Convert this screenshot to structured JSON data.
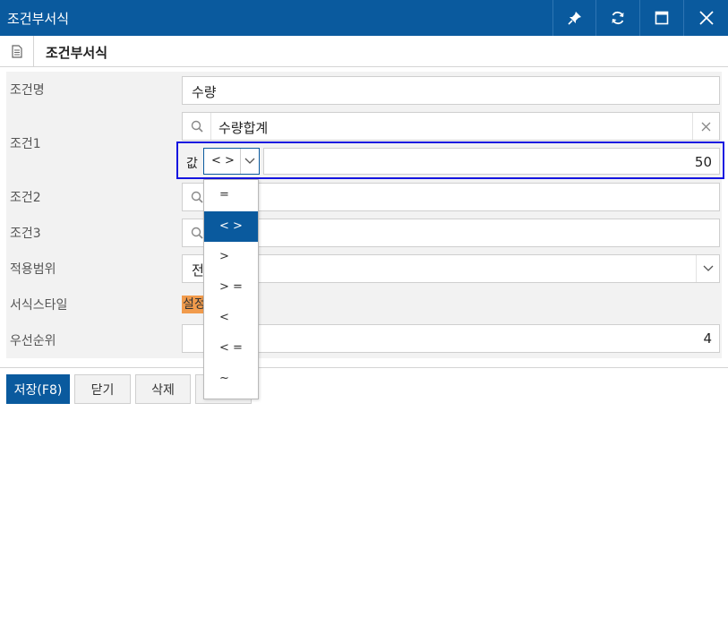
{
  "window": {
    "title": "조건부서식"
  },
  "tab": {
    "title": "조건부서식"
  },
  "form": {
    "name_label": "조건명",
    "name_value": "수량",
    "cond1_label": "조건1",
    "cond1_field": "수량합계",
    "cond1_value_label": "값",
    "cond1_operator": "< >",
    "cond1_value": "50",
    "cond2_label": "조건2",
    "cond3_label": "조건3",
    "scope_label": "적용범위",
    "scope_value_partial": "전",
    "style_label": "서식스타일",
    "style_button": "설정",
    "priority_label": "우선순위",
    "priority_value": "4"
  },
  "buttons": {
    "save": "저장(F8)",
    "close": "닫기",
    "delete": "삭제"
  },
  "operator_options": [
    "=",
    "< >",
    ">",
    "> =",
    "<",
    "< =",
    "~"
  ],
  "colors": {
    "accent": "#0a5a9e",
    "focus_border": "#1515e0",
    "style_chip": "#f19b4c"
  }
}
